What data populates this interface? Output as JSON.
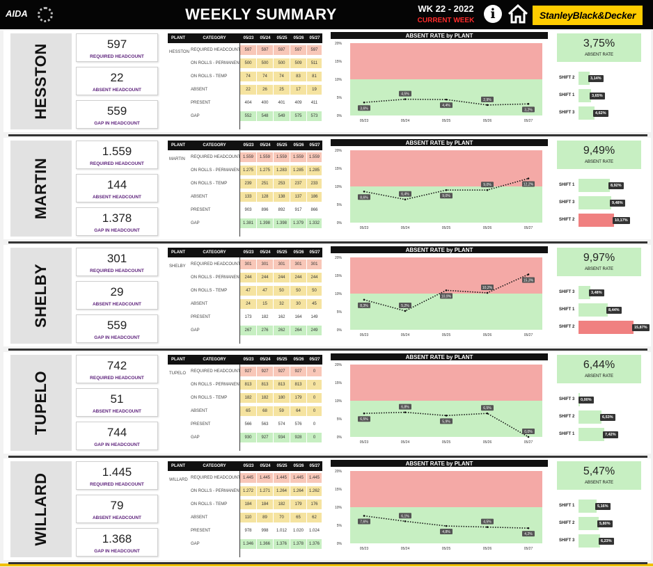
{
  "header": {
    "logo_text": "AIDA",
    "title": "WEEKLY SUMMARY",
    "week": "WK 22 - 2022",
    "current_week": "CURRENT WEEK",
    "brand": "StanleyBlack&Decker"
  },
  "colors": {
    "header_bg": "#050505",
    "red_zone": "#f4a9a6",
    "green_zone": "#c7efc2",
    "yellow": "#f5e3a0",
    "salmon": "#f8c7b8",
    "red_bar": "#f08080",
    "brand_yellow": "#ffcc00"
  },
  "labels": {
    "required": "REQUIRED HEADCOUNT",
    "absent": "ABSENT HEADCOUNT",
    "gap": "GAP IN HEADCOUNT",
    "absent_rate": "ABSENT RATE",
    "chart_title": "ABSENT RATE by PLANT"
  },
  "table_headers": {
    "plant": "PLANT",
    "category": "CATEGORY",
    "dates": [
      "05/23",
      "05/24",
      "05/25",
      "05/26",
      "05/27"
    ]
  },
  "categories": [
    "REQUIRED HEADCOUNT",
    "ON ROLLS - PERMANENT",
    "ON ROLLS - TEMP",
    "ABSENT",
    "PRESENT",
    "GAP"
  ],
  "plants": [
    {
      "name": "HESSTON",
      "required": "597",
      "absent": "22",
      "gap": "559",
      "rows": [
        [
          "597",
          "597",
          "597",
          "597",
          "597"
        ],
        [
          "500",
          "500",
          "500",
          "509",
          "511"
        ],
        [
          "74",
          "74",
          "74",
          "83",
          "81"
        ],
        [
          "22",
          "26",
          "25",
          "17",
          "19"
        ],
        [
          "404",
          "400",
          "401",
          "409",
          "411"
        ],
        [
          "552",
          "548",
          "549",
          "575",
          "573"
        ]
      ],
      "absent_rate": "3,75%",
      "chart_labels": [
        "3,6%",
        "4,5%",
        "4,4%",
        "2,9%",
        "3,2%"
      ],
      "shifts": [
        {
          "name": "SHIFT 2",
          "label": "3,14%",
          "pct": 3.14,
          "red": false
        },
        {
          "name": "SHIFT 1",
          "label": "3,65%",
          "pct": 3.65,
          "red": false
        },
        {
          "name": "SHIFT 3",
          "label": "4,62%",
          "pct": 4.62,
          "red": false
        }
      ]
    },
    {
      "name": "MARTIN",
      "required": "1.559",
      "absent": "144",
      "gap": "1.378",
      "rows": [
        [
          "1.559",
          "1.559",
          "1.559",
          "1.559",
          "1.559"
        ],
        [
          "1.275",
          "1.275",
          "1.283",
          "1.285",
          "1.285"
        ],
        [
          "239",
          "251",
          "253",
          "237",
          "233"
        ],
        [
          "133",
          "128",
          "138",
          "137",
          "186"
        ],
        [
          "903",
          "896",
          "892",
          "917",
          "866"
        ],
        [
          "1.381",
          "1.398",
          "1.398",
          "1.379",
          "1.332"
        ]
      ],
      "absent_rate": "9,49%",
      "chart_labels": [
        "8,6%",
        "6,4%",
        "9,0%",
        "9,0%",
        "12,2%"
      ],
      "shifts": [
        {
          "name": "SHIFT 1",
          "label": "8,92%",
          "pct": 8.92,
          "red": false
        },
        {
          "name": "SHIFT 3",
          "label": "9,48%",
          "pct": 9.48,
          "red": false
        },
        {
          "name": "SHIFT 2",
          "label": "10,17%",
          "pct": 10.17,
          "red": true
        }
      ]
    },
    {
      "name": "SHELBY",
      "required": "301",
      "absent": "29",
      "gap": "559",
      "rows": [
        [
          "301",
          "301",
          "301",
          "301",
          "301"
        ],
        [
          "244",
          "244",
          "244",
          "244",
          "244"
        ],
        [
          "47",
          "47",
          "50",
          "50",
          "50"
        ],
        [
          "24",
          "15",
          "32",
          "30",
          "45"
        ],
        [
          "173",
          "182",
          "162",
          "164",
          "149"
        ],
        [
          "267",
          "276",
          "262",
          "264",
          "249"
        ]
      ],
      "absent_rate": "9,97%",
      "chart_labels": [
        "8,3%",
        "5,2%",
        "10,9%",
        "10,2%",
        "15,3%"
      ],
      "shifts": [
        {
          "name": "SHIFT 3",
          "label": "3,48%",
          "pct": 3.48,
          "red": false
        },
        {
          "name": "SHIFT 1",
          "label": "8,44%",
          "pct": 8.44,
          "red": false
        },
        {
          "name": "SHIFT 2",
          "label": "15,87%",
          "pct": 15.87,
          "red": true
        }
      ]
    },
    {
      "name": "TUPELO",
      "required": "742",
      "absent": "51",
      "gap": "744",
      "rows": [
        [
          "927",
          "927",
          "927",
          "927",
          "0"
        ],
        [
          "813",
          "813",
          "813",
          "813",
          "0"
        ],
        [
          "182",
          "182",
          "180",
          "179",
          "0"
        ],
        [
          "65",
          "68",
          "59",
          "64",
          "0"
        ],
        [
          "566",
          "563",
          "574",
          "576",
          "0"
        ],
        [
          "930",
          "927",
          "934",
          "928",
          "0"
        ]
      ],
      "absent_rate": "6,44%",
      "chart_labels": [
        "6,5%",
        "6,8%",
        "5,9%",
        "6,5%",
        "0,0%"
      ],
      "shifts": [
        {
          "name": "SHIFT 3",
          "label": "0,00%",
          "pct": 0.0,
          "red": false
        },
        {
          "name": "SHIFT 2",
          "label": "6,53%",
          "pct": 6.53,
          "red": false
        },
        {
          "name": "SHIFT 1",
          "label": "7,42%",
          "pct": 7.42,
          "red": false
        }
      ]
    },
    {
      "name": "WILLARD",
      "required": "1.445",
      "absent": "79",
      "gap": "1.368",
      "rows": [
        [
          "1.445",
          "1.445",
          "1.445",
          "1.445",
          "1.445"
        ],
        [
          "1.272",
          "1.271",
          "1.264",
          "1.264",
          "1.262"
        ],
        [
          "184",
          "184",
          "182",
          "179",
          "176"
        ],
        [
          "110",
          "89",
          "70",
          "65",
          "62"
        ],
        [
          "978",
          "998",
          "1.012",
          "1.020",
          "1.024"
        ],
        [
          "1.346",
          "1.366",
          "1.376",
          "1.378",
          "1.376"
        ]
      ],
      "absent_rate": "5,47%",
      "chart_labels": [
        "7,6%",
        "6,1%",
        "4,8%",
        "4,5%",
        "4,2%"
      ],
      "shifts": [
        {
          "name": "SHIFT 1",
          "label": "5,16%",
          "pct": 5.16,
          "red": false
        },
        {
          "name": "SHIFT 2",
          "label": "5,80%",
          "pct": 5.8,
          "red": false
        },
        {
          "name": "SHIFT 3",
          "label": "6,23%",
          "pct": 6.23,
          "red": false
        }
      ]
    }
  ],
  "chart_data": [
    {
      "type": "line",
      "title": "ABSENT RATE by PLANT",
      "categories": [
        "05/23",
        "05/24",
        "05/25",
        "05/26",
        "05/27"
      ],
      "values": [
        3.6,
        4.5,
        4.4,
        2.9,
        3.2
      ],
      "ylim": [
        0,
        20
      ],
      "yticks": [
        "0%",
        "5%",
        "10%",
        "15%",
        "20%"
      ]
    },
    {
      "type": "line",
      "title": "ABSENT RATE by PLANT",
      "categories": [
        "05/23",
        "05/24",
        "05/25",
        "05/26",
        "05/27"
      ],
      "values": [
        8.6,
        6.4,
        9.0,
        9.0,
        12.2
      ],
      "ylim": [
        0,
        20
      ],
      "yticks": [
        "0%",
        "5%",
        "10%",
        "15%",
        "20%"
      ]
    },
    {
      "type": "line",
      "title": "ABSENT RATE by PLANT",
      "categories": [
        "05/23",
        "05/24",
        "05/25",
        "05/26",
        "05/27"
      ],
      "values": [
        8.3,
        5.2,
        10.9,
        10.2,
        15.3
      ],
      "ylim": [
        0,
        20
      ],
      "yticks": [
        "0%",
        "5%",
        "10%",
        "15%",
        "20%"
      ]
    },
    {
      "type": "line",
      "title": "ABSENT RATE by PLANT",
      "categories": [
        "05/23",
        "05/24",
        "05/25",
        "05/26",
        "05/27"
      ],
      "values": [
        6.5,
        6.8,
        5.9,
        6.5,
        0.0
      ],
      "ylim": [
        0,
        20
      ],
      "yticks": [
        "0%",
        "5%",
        "10%",
        "15%",
        "20%"
      ]
    },
    {
      "type": "line",
      "title": "ABSENT RATE by PLANT",
      "categories": [
        "05/23",
        "05/24",
        "05/25",
        "05/26",
        "05/27"
      ],
      "values": [
        7.6,
        6.1,
        4.8,
        4.5,
        4.2
      ],
      "ylim": [
        0,
        20
      ],
      "yticks": [
        "0%",
        "5%",
        "10%",
        "15%",
        "20%"
      ]
    }
  ]
}
